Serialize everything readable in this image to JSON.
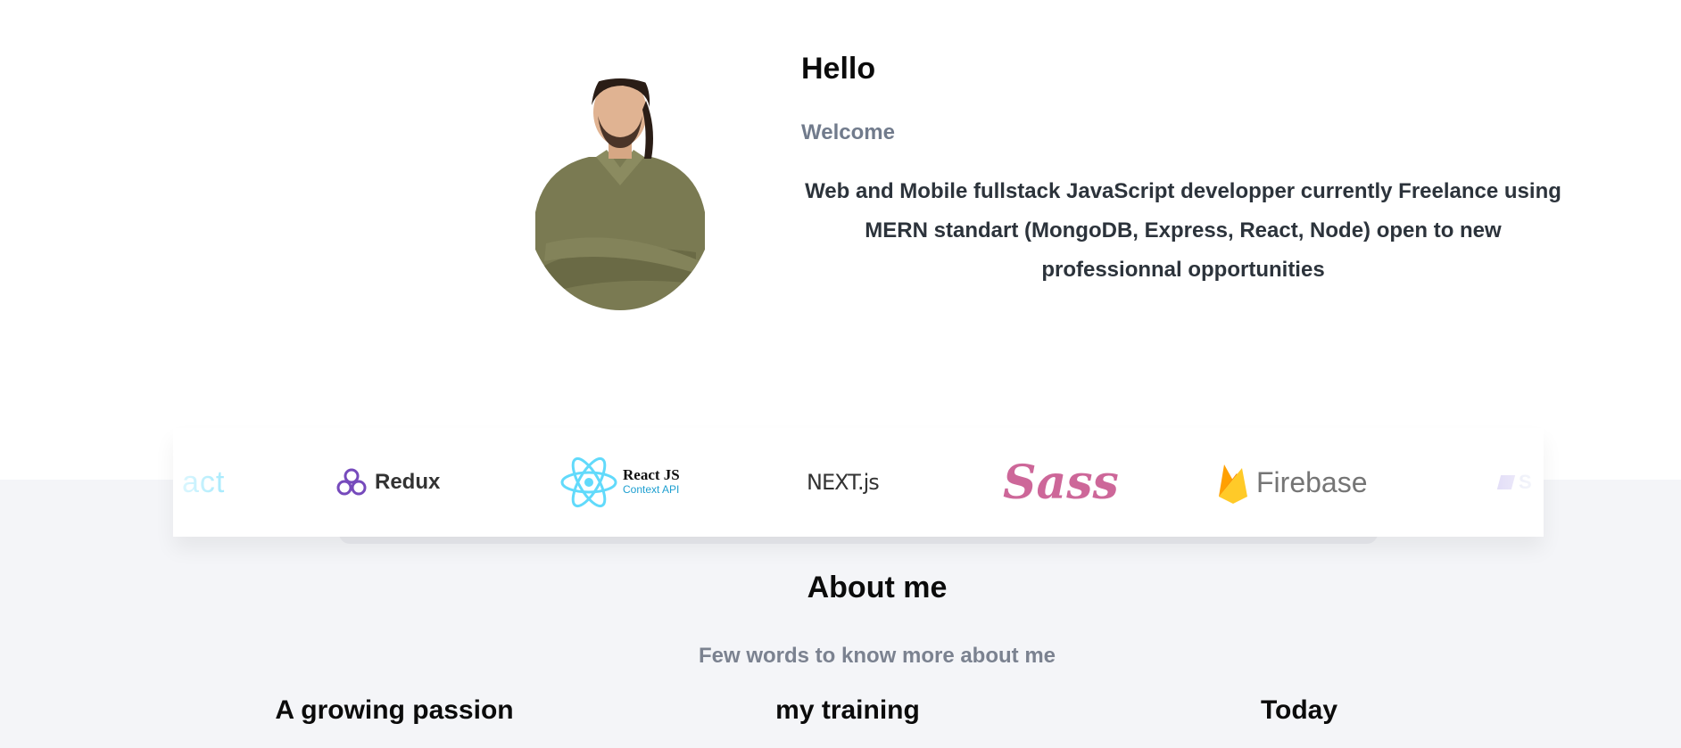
{
  "hero": {
    "title": "Hello",
    "subtitle": "Welcome",
    "intro": "Web and Mobile fullstack JavaScript developper currently Freelance using MERN standart (MongoDB, Express, React, Node) open to new professionnal opportunities"
  },
  "tech_strip": {
    "items": [
      {
        "label": "act",
        "icon": "react-partial-text"
      },
      {
        "label": "Redux",
        "icon": "redux-icon"
      },
      {
        "label": "React JS",
        "sublabel": "Context API",
        "icon": "react-atom-icon"
      },
      {
        "label": "NEXT.js",
        "icon": "nextjs-icon"
      },
      {
        "label": "Sass",
        "icon": "sass-icon"
      },
      {
        "label": "Firebase",
        "icon": "firebase-icon"
      },
      {
        "label": "S",
        "icon": "styled-partial"
      }
    ]
  },
  "about": {
    "title": "About me",
    "subtitle": "Few words to know more about me",
    "columns": [
      "A growing passion",
      "my training",
      "Today"
    ]
  },
  "colors": {
    "redux": "#764abc",
    "react": "#61dafb",
    "sass": "#cd6799",
    "firebase_orange": "#f6820d",
    "firebase_yellow": "#ffca28",
    "muted": "#717b8c",
    "lower_bg": "#f4f5f8"
  }
}
